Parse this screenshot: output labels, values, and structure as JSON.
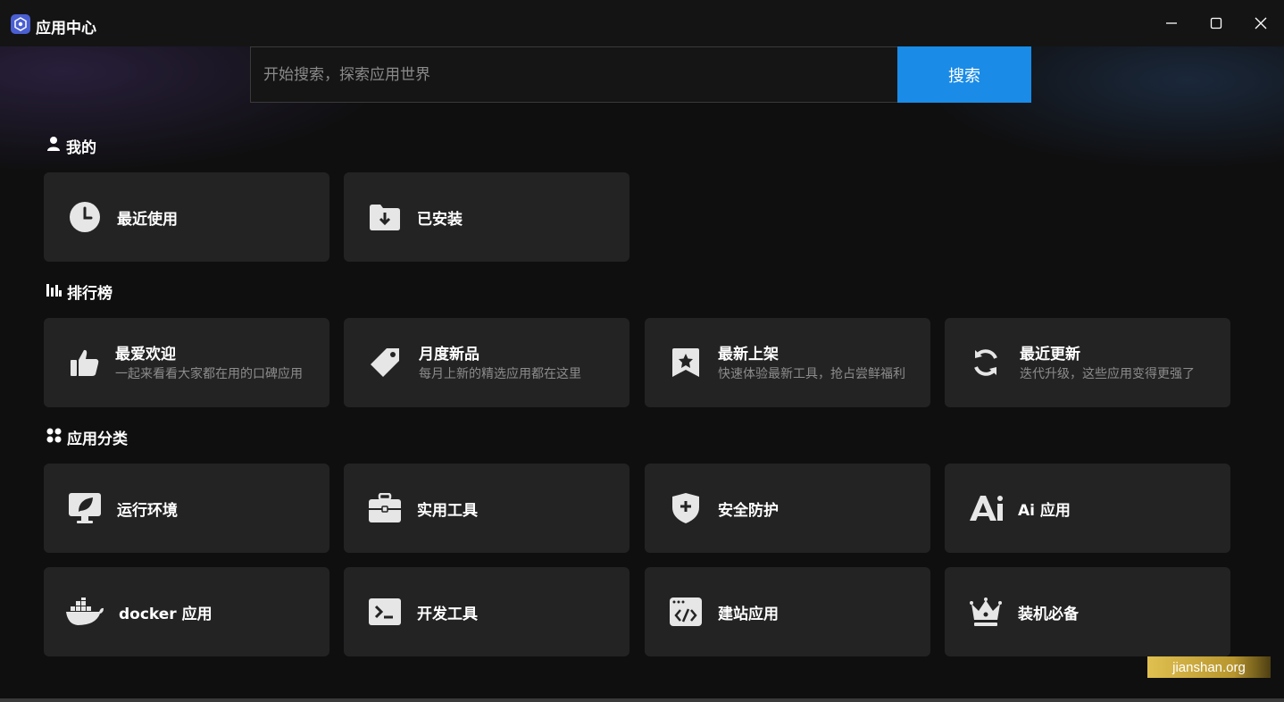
{
  "window": {
    "title": "应用中心",
    "controls": [
      "minimize-icon",
      "maximize-icon",
      "close-icon"
    ]
  },
  "search": {
    "placeholder": "开始搜索，探索应用世界",
    "button_label": "搜索"
  },
  "sections": {
    "mine": {
      "title": "我的",
      "icon": "user-icon",
      "items": [
        {
          "label": "最近使用",
          "icon": "clock-icon"
        },
        {
          "label": "已安装",
          "icon": "folder-download-icon"
        }
      ]
    },
    "ranking": {
      "title": "排行榜",
      "icon": "bar-chart-icon",
      "items": [
        {
          "label": "最爱欢迎",
          "desc": "一起来看看大家都在用的口碑应用",
          "icon": "thumbs-up-icon"
        },
        {
          "label": "月度新品",
          "desc": "每月上新的精选应用都在这里",
          "icon": "tag-icon"
        },
        {
          "label": "最新上架",
          "desc": "快速体验最新工具，抢占尝鲜福利",
          "icon": "star-bookmark-icon"
        },
        {
          "label": "最近更新",
          "desc": "迭代升级，这些应用变得更强了",
          "icon": "refresh-icon"
        }
      ]
    },
    "categories": {
      "title": "应用分类",
      "icon": "grid-dots-icon",
      "items": [
        {
          "label": "运行环境",
          "icon": "monitor-leaf-icon"
        },
        {
          "label": "实用工具",
          "icon": "briefcase-icon"
        },
        {
          "label": "安全防护",
          "icon": "shield-plus-icon"
        },
        {
          "label": "Ai 应用",
          "icon": "ai-icon"
        },
        {
          "label": "docker 应用",
          "icon": "docker-icon"
        },
        {
          "label": "开发工具",
          "icon": "terminal-icon"
        },
        {
          "label": "建站应用",
          "icon": "code-window-icon"
        },
        {
          "label": "装机必备",
          "icon": "crown-icon"
        }
      ]
    }
  },
  "watermark": "jianshan.org",
  "colors": {
    "accent": "#1a8be6",
    "card_bg": "#232323",
    "page_bg": "#0f0f10"
  }
}
